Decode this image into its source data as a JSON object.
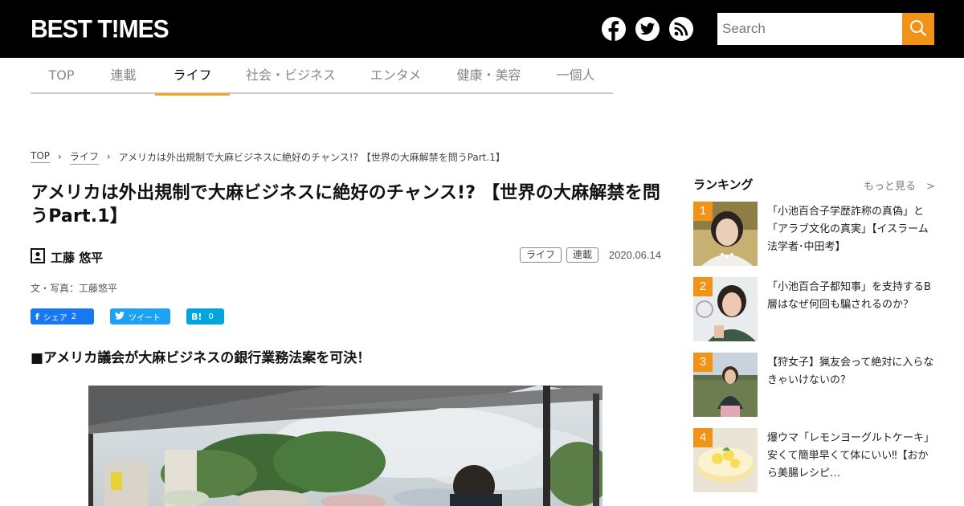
{
  "header": {
    "logo_text": "BEST T!MES",
    "social": [
      "facebook-icon",
      "twitter-icon",
      "rss-icon"
    ],
    "search_placeholder": "Search",
    "accent": "#f29217"
  },
  "nav": {
    "items": [
      {
        "label": "TOP"
      },
      {
        "label": "連載"
      },
      {
        "label": "ライフ"
      },
      {
        "label": "社会・ビジネス"
      },
      {
        "label": "エンタメ"
      },
      {
        "label": "健康・美容"
      },
      {
        "label": "一個人"
      }
    ],
    "active": "ライフ"
  },
  "breadcrumb": {
    "items": [
      "TOP",
      "ライフ"
    ],
    "current": "アメリカは外出規制で大麻ビジネスに絶好のチャンス!? 【世界の大麻解禁を問うPart.1】"
  },
  "article": {
    "title": "アメリカは外出規制で大麻ビジネスに絶好のチャンス!? 【世界の大麻解禁を問うPart.1】",
    "author": "工藤 悠平",
    "tags": [
      "ライフ",
      "連載"
    ],
    "date": "2020.06.14",
    "credit": "文・写真：工藤悠平",
    "share": {
      "facebook_label": "シェア",
      "facebook_count": "2",
      "twitter_label": "ツイート",
      "hatena_label": "B!",
      "hatena_count": "0"
    },
    "subheading": "■アメリカ議会が大麻ビジネスの銀行業務法案を可決！"
  },
  "sidebar": {
    "heading": "ランキング",
    "more": "もっと見る　>",
    "items": [
      {
        "rank": "1",
        "text": "「小池百合子学歴詐称の真偽」と「アラブ文化の真実」【イスラーム法学者･中田考】"
      },
      {
        "rank": "2",
        "text": "「小池百合子都知事」を支持するB層はなぜ何回も騙されるのか？"
      },
      {
        "rank": "3",
        "text": "【狩女子】猟友会って絶対に入らなきゃいけないの？"
      },
      {
        "rank": "4",
        "text": "爆ウマ「レモンヨーグルトケーキ」安くて簡単早くて体にいい‼︎【おから美腸レシピ…"
      }
    ]
  }
}
